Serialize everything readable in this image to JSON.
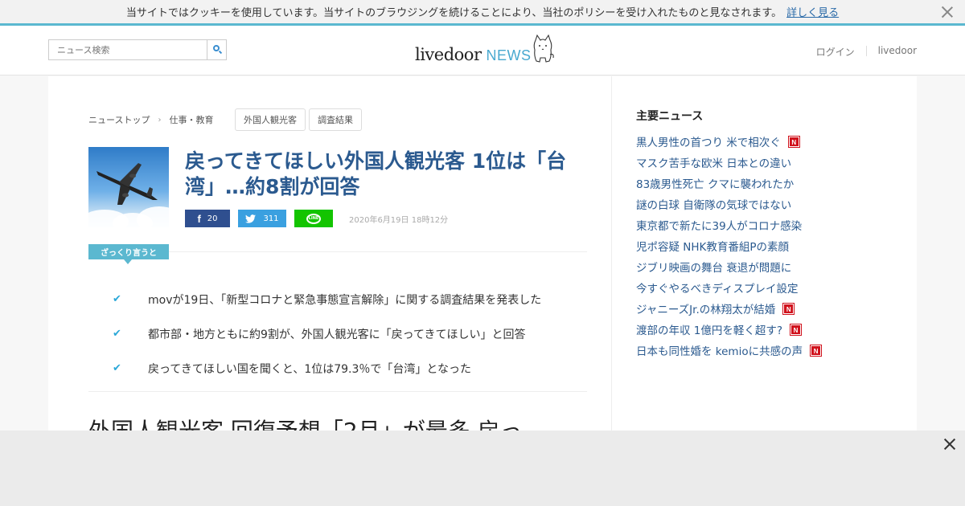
{
  "cookie": {
    "message": "当サイトではクッキーを使用しています。当サイトのブラウジングを続けることにより、当社のポリシーを受け入れたものと見なされます。",
    "link": "詳しく見る"
  },
  "header": {
    "search_placeholder": "ニュース検索",
    "logo_main": "livedoor",
    "logo_news": "NEWS",
    "login": "ログイン",
    "livedoor_link": "livedoor"
  },
  "breadcrumb": {
    "items": [
      "ニューストップ",
      "仕事・教育"
    ]
  },
  "tags": [
    "外国人観光客",
    "調査結果"
  ],
  "article": {
    "title": "戻ってきてほしい外国人観光客 1位は「台湾」…約8割が回答",
    "share": {
      "facebook_count": "20",
      "twitter_count": "311"
    },
    "date": "2020年6月19日 18時12分",
    "summary_label": "ざっくり言うと",
    "bullets": [
      "movが19日、「新型コロナと緊急事態宣言解除」に関する調査結果を発表した",
      "都市部・地方ともに約9割が、外国人観光客に「戻ってきてほしい」と回答",
      "戻ってきてほしい国を聞くと、1位は79.3％で「台湾」となった"
    ],
    "headline": "外国人観光客 回復予想「2月」が最多 戻っ"
  },
  "sidebar": {
    "title": "主要ニュース",
    "news": [
      {
        "text": "黒人男性の首つり 米で相次ぐ",
        "new": true
      },
      {
        "text": "マスク苦手な欧米 日本との違い",
        "new": false
      },
      {
        "text": "83歳男性死亡 クマに襲われたか",
        "new": false
      },
      {
        "text": "謎の白球 自衛隊の気球ではない",
        "new": false
      },
      {
        "text": "東京都で新たに39人がコロナ感染",
        "new": false
      },
      {
        "text": "児ポ容疑 NHK教育番組Pの素顔",
        "new": false
      },
      {
        "text": "ジブリ映画の舞台 衰退が問題に",
        "new": false
      },
      {
        "text": "今すぐやるべきディスプレイ設定",
        "new": false
      },
      {
        "text": "ジャニーズJr.の林翔太が結婚",
        "new": true
      },
      {
        "text": "渡部の年収 1億円を軽く超す?",
        "new": true
      },
      {
        "text": "日本も同性婚を kemioに共感の声",
        "new": true
      }
    ],
    "new_badge": "N"
  },
  "colors": {
    "accent": "#5bb8d0",
    "link": "#2b5a8f",
    "badge": "#d0111b"
  }
}
